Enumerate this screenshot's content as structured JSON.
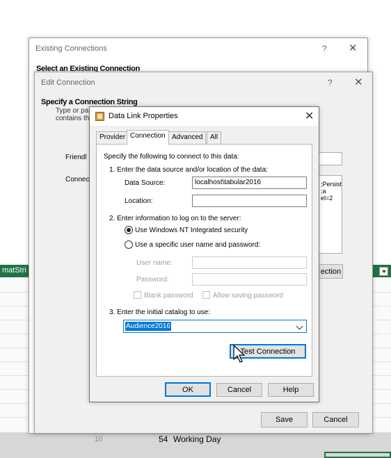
{
  "excel": {
    "header_fragment": "matStri",
    "row_number": "10",
    "cell_value": "54",
    "cell_text": "Working Day"
  },
  "existing_connections": {
    "title": "Existing Connections",
    "help": "?",
    "close": "✕",
    "header": "Select an Existing Connection"
  },
  "edit_connection": {
    "title": "Edit Connection",
    "help": "?",
    "close": "✕",
    "header": "Specify a Connection String",
    "desc_line1": "Type or pa",
    "desc_line2": "contains th",
    "friendly_label": "Friendl",
    "connection_label": "Connec",
    "side_line1": ";Persist",
    "side_line2": ";a",
    "side_line3": "el=2",
    "build_button": "ection",
    "save_button": "Save",
    "cancel_button": "Cancel"
  },
  "data_link": {
    "title": "Data Link Properties",
    "close": "✕",
    "tabs": [
      "Provider",
      "Connection",
      "Advanced",
      "All"
    ],
    "intro": "Specify the following to connect to this data:",
    "step1": "1. Enter the data source and/or location of the data:",
    "data_source_label": "Data Source:",
    "data_source_value": "localhost\\tabular2016",
    "location_label": "Location:",
    "location_value": "",
    "step2": "2. Enter information to log on to the server:",
    "radio_windows": "Use Windows NT Integrated security",
    "radio_specific": "Use a specific user name and password:",
    "username_label": "User name:",
    "password_label": "Password:",
    "blank_password": "Blank password",
    "allow_saving": "Allow saving password",
    "step3": "3. Enter the initial catalog to use:",
    "catalog_value": "Audience2016",
    "test_connection": "Test Connection",
    "ok": "OK",
    "cancel": "Cancel",
    "help": "Help"
  },
  "colors": {
    "accent": "#0078d7",
    "excel_green": "#217346"
  }
}
